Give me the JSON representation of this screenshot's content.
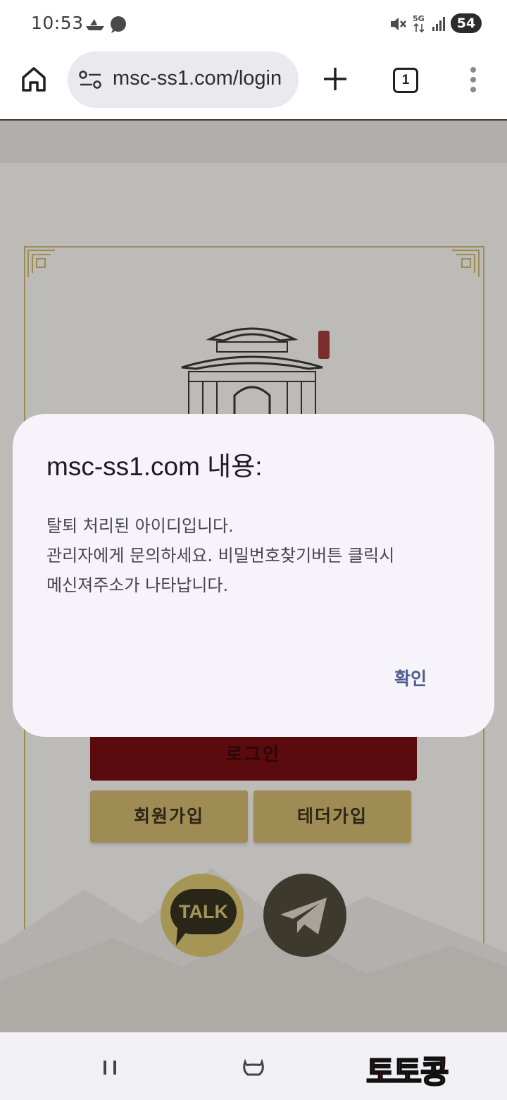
{
  "status_bar": {
    "time": "10:53",
    "network": "5G",
    "battery": "54",
    "icons": [
      "boat-icon",
      "cloud-chat-icon",
      "mute-icon",
      "5g-icon",
      "signal-icon",
      "battery-icon"
    ]
  },
  "browser": {
    "url": "msc-ss1.com/login",
    "tab_count": "1",
    "icons": [
      "home-icon",
      "site-settings-icon",
      "new-tab-plus-icon",
      "tabs-icon",
      "more-vert-icon"
    ]
  },
  "page": {
    "login_button": "로그인",
    "signup_button": "회원가입",
    "tether_signup_button": "테더가입",
    "kakao_label": "TALK",
    "colors": {
      "login": "#5b0a0d",
      "gold": "#9e8c54",
      "frame": "#9c8b57"
    }
  },
  "dialog": {
    "title": "msc-ss1.com 내용:",
    "lines": [
      "탈퇴 처리된 아이디입니다.",
      "관리자에게 문의하세요. 비밀번호찾기버튼 클릭시",
      "메신져주소가 나타납니다."
    ],
    "ok_label": "확인",
    "accent": "#4a5c8c"
  },
  "nav": {
    "watermark": "토토콩",
    "icons": [
      "recents-icon",
      "home-gesture-icon"
    ]
  }
}
